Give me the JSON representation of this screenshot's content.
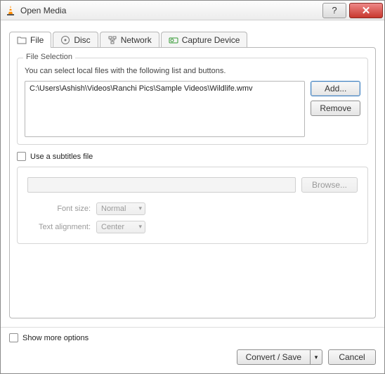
{
  "window": {
    "title": "Open Media"
  },
  "tabs": {
    "file": "File",
    "disc": "Disc",
    "network": "Network",
    "capture": "Capture Device"
  },
  "file_selection": {
    "group_title": "File Selection",
    "hint": "You can select local files with the following list and buttons.",
    "files": [
      "C:\\Users\\Ashish\\Videos\\Ranchi Pics\\Sample Videos\\Wildlife.wmv"
    ],
    "add_label": "Add...",
    "remove_label": "Remove"
  },
  "subtitles": {
    "checkbox_label": "Use a subtitles file",
    "browse_label": "Browse...",
    "font_size_label": "Font size:",
    "font_size_value": "Normal",
    "alignment_label": "Text alignment:",
    "alignment_value": "Center"
  },
  "footer": {
    "more_label": "Show more options",
    "convert_label": "Convert / Save",
    "cancel_label": "Cancel"
  }
}
